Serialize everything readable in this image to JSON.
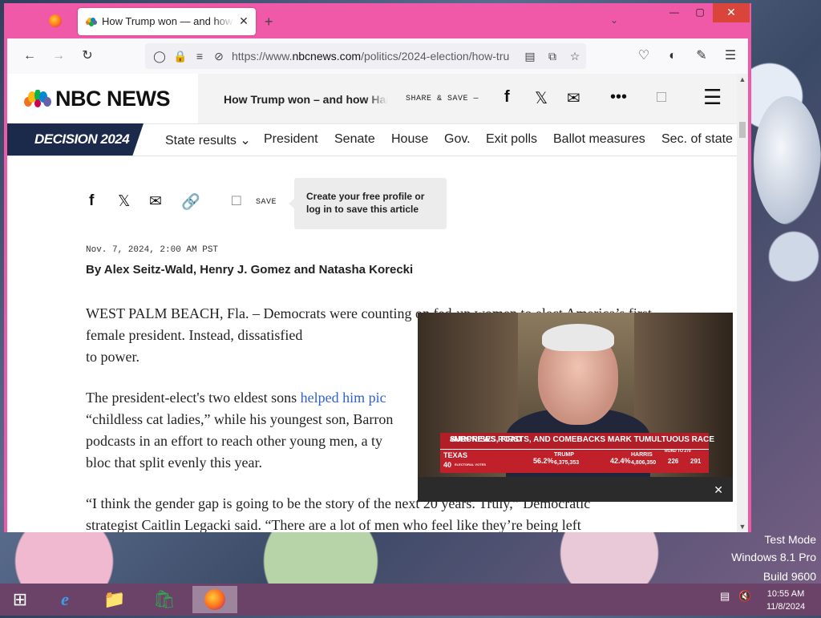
{
  "browser": {
    "tab_title": "How Trump won — and how H",
    "tab_close": "✕",
    "new_tab": "+",
    "list_all_tabs": "⌄",
    "url_prefix": "https://www.",
    "url_domain": "nbcnews.com",
    "url_path": "/politics/2024-election/how-tru",
    "win_minimize": "—",
    "win_maximize": "▢",
    "win_close": "✕"
  },
  "header": {
    "logo": "NBC NEWS",
    "article_title": "How Trump won – and how Har",
    "share_save": "SHARE & SAVE —"
  },
  "decision_nav": {
    "badge": "DECISION 2024",
    "items": [
      "State results ⌄",
      "President",
      "Senate",
      "House",
      "Gov.",
      "Exit polls",
      "Ballot measures",
      "Sec. of state"
    ]
  },
  "article": {
    "save_label": "SAVE",
    "tooltip": "Create your free profile or log in to save this article",
    "dateline": "Nov. 7, 2024, 2:00 AM PST",
    "byline": "By Alex Seitz-Wald, Henry J. Gomez and Natasha Korecki",
    "p1": "WEST PALM BEACH, Fla. – Democrats were counting on fed-up women to elect America’s first female president. Instead, dissatisfied",
    "p1_end": "to power.",
    "p2_start": "The president-elect's two eldest sons ",
    "p2_link": "helped him pic",
    "p2_l2": "“childless cat ladies,” while his youngest son, Barron",
    "p2_l3": "podcasts in an effort to reach other young men, a ty",
    "p2_l4": "bloc that split evenly this year.",
    "p3_l1": "“I think the gender gap is going to be the story of the next 20 years. Truly,” Democratic",
    "p3_l2": "strategist Caitlin Legacki said. “There are a lot of men who feel like they’re being left"
  },
  "video": {
    "headline": "SURPRISES, FIRSTS, AND COMEBACKS MARK TUMULTUOUS RACE",
    "network_tag": "#NBCNEWS ROAD",
    "state": "TEXAS",
    "electoral_votes": "40",
    "electoral_label": "ELECTORAL VOTES",
    "trump_label": "TRUMP",
    "trump_pct": "56.2%",
    "trump_votes": "6,375,353",
    "harris_label": "HARRIS",
    "harris_pct": "42.4%",
    "harris_votes": "4,806,350",
    "road_label": "ROAD TO 270",
    "harris_ev": "226",
    "trump_ev": "291",
    "close": "✕"
  },
  "system": {
    "mode": "Test Mode",
    "os": "Windows 8.1 Pro",
    "build": "Build 9600",
    "time": "10:55 AM",
    "date": "11/8/2024"
  },
  "colors": {
    "window_frame": "#ef59a8",
    "nbc_blue": "#1b2a4a",
    "link": "#3061d0",
    "lower_third_red": "#c0202a",
    "taskbar": "#6b4368"
  }
}
